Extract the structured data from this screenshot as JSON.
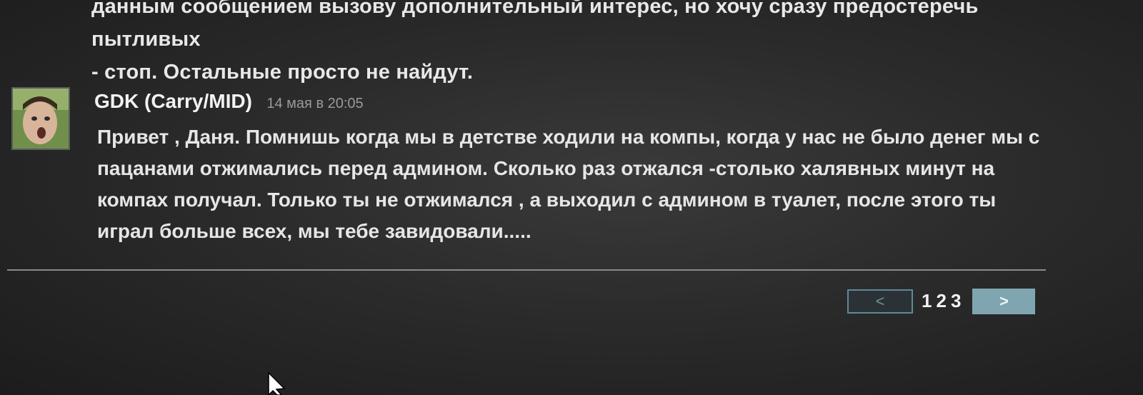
{
  "previous_comment": {
    "text_lines": [
      "данным сообщением вызову дополнительный интерес, но хочу сразу предостеречь пытливых",
      "- стоп. Остальные просто не найдут."
    ]
  },
  "comment": {
    "author": "GDK (Carry/MID)",
    "timestamp": "14 мая в 20:05",
    "body_lines": [
      "Привет , Даня. Помнишь когда мы в детстве ходили на компы, когда у нас не было денег мы с",
      "пацанами отжимались перед админом. Сколько раз отжался -столько халявных минут на",
      "компах получал. Только ты не отжимался , а выходил с админом в туалет, после этого ты",
      "играл больше всех, мы тебе завидовали....."
    ]
  },
  "pagination": {
    "prev_label": "<",
    "pages": [
      "1",
      "2",
      "3"
    ],
    "next_label": ">"
  },
  "colors": {
    "background": "#2b2b2b",
    "text": "#e6e6e6",
    "timestamp": "#9a9a9a",
    "pager_accent": "#7fa6b0"
  }
}
